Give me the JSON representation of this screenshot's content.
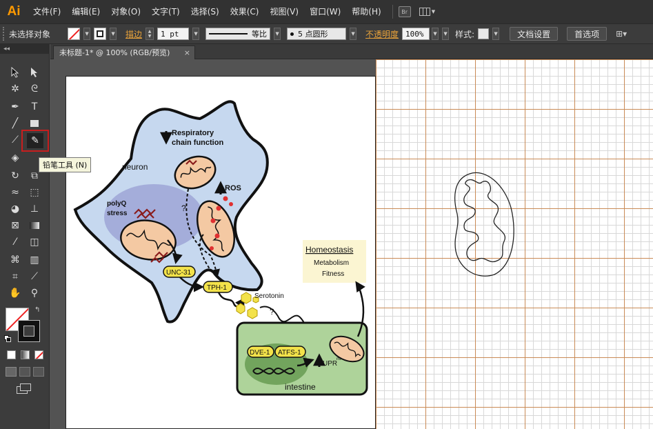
{
  "app": {
    "logo": "Ai",
    "menu": [
      "文件(F)",
      "编辑(E)",
      "对象(O)",
      "文字(T)",
      "选择(S)",
      "效果(C)",
      "视图(V)",
      "窗口(W)",
      "帮助(H)"
    ],
    "bridge_label": "Br"
  },
  "control_bar": {
    "selection_status": "未选择对象",
    "stroke_label": "描边",
    "stroke_weight": "1 pt",
    "stroke_profile": "等比",
    "brush": "5 点圆形",
    "opacity_label": "不透明度",
    "opacity_value": "100%",
    "style_label": "样式:",
    "doc_setup_button": "文档设置",
    "preferences_button": "首选项"
  },
  "toolbox": {
    "collapse_label": "◂◂",
    "tooltip": "铅笔工具 (N)"
  },
  "document": {
    "tab_title": "未标题-1* @ 100% (RGB/预览)",
    "tab_close": "×"
  },
  "figure": {
    "respiratory_line1": "Respiratory",
    "respiratory_line2": "chain function",
    "neuron_label": "neuron",
    "polyq_line1": "polyQ",
    "polyq_line2": "stress",
    "ros_label": "ROS",
    "unc31_label": "UNC-31",
    "tph1_label": "TPH-1",
    "serotonin_label": "Serotonin",
    "question_mark": "?",
    "homeostasis_title": "Homeostasis",
    "metabolism_label": "Metabolism",
    "fitness_label": "Fitness",
    "dve1_label": "DVE-1",
    "atfs1_label": "ATFS-1",
    "upr_label": "UPR",
    "upr_sup": "mt",
    "intestine_label": "intestine"
  }
}
